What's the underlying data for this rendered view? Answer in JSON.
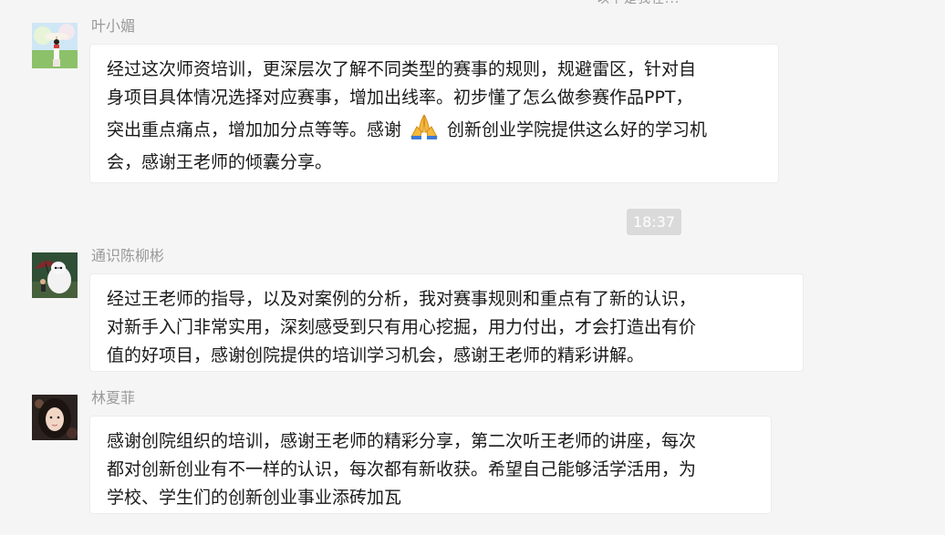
{
  "top_fragment": "以下是我在...",
  "time_divider": "18:37",
  "messages": [
    {
      "sender": "叶小媚",
      "lines": [
        "经过这次师资培训，更深层次了解不同类型的赛事的规则，规避雷区，针对自",
        "身项目具体情况选择对应赛事，增加出线率。初步懂了怎么做参赛作品PPT，",
        "突出重点痛点，增加加分点等等。感谢",
        "创新创业学院提供这么好的学习机",
        "会，感谢王老师的倾囊分享。"
      ],
      "emoji": "folded-hands-emoji"
    },
    {
      "sender": "通识陈柳彬",
      "lines": [
        "经过王老师的指导，以及对案例的分析，我对赛事规则和重点有了新的认识，",
        "对新手入门非常实用，深刻感受到只有用心挖掘，用力付出，才会打造出有价",
        "值的好项目，感谢创院提供的培训学习机会，感谢王老师的精彩讲解。"
      ]
    },
    {
      "sender": "林夏菲",
      "lines": [
        "感谢创院组织的培训，感谢王老师的精彩分享，第二次听王老师的讲座，每次",
        "都对创新创业有不一样的认识，每次都有新收获。希望自己能够活学活用，为",
        "学校、学生们的创新创业事业添砖加瓦"
      ]
    }
  ],
  "colors": {
    "background": "#f5f5f5",
    "bubble": "#ffffff",
    "sender_name": "#9a9a9a",
    "time_badge": "#dadada"
  }
}
